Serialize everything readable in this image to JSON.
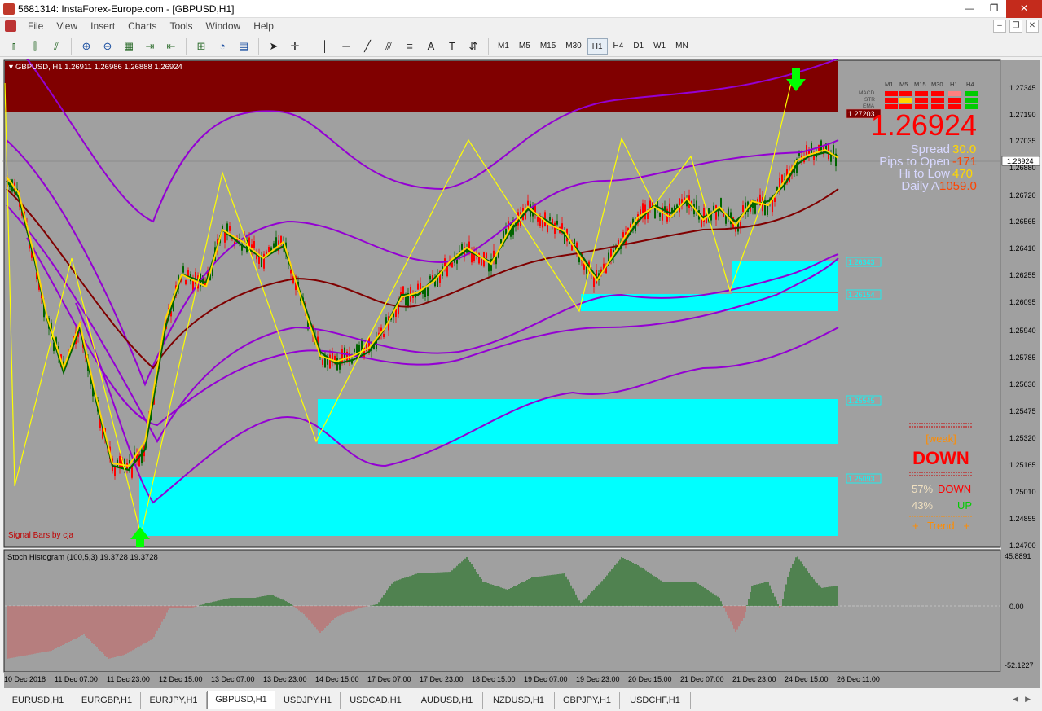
{
  "window": {
    "title": "5681314: InstaForex-Europe.com - [GBPUSD,H1]",
    "controls": [
      "—",
      "❐",
      "✕"
    ]
  },
  "menu": {
    "items": [
      "File",
      "View",
      "Insert",
      "Charts",
      "Tools",
      "Window",
      "Help"
    ],
    "right_icons": [
      "–",
      "❐",
      "✕"
    ]
  },
  "toolbar": {
    "timeframes": [
      "M1",
      "M5",
      "M15",
      "M30",
      "H1",
      "H4",
      "D1",
      "W1",
      "MN"
    ],
    "active_timeframe": "H1"
  },
  "chart": {
    "header": "GBPUSD, H1  1.26911 1.26986 1.26888 1.26924",
    "price_labels": [
      "1.27345",
      "1.27190",
      "1.27035",
      "1.26880",
      "1.26720",
      "1.26565",
      "1.26410",
      "1.26255",
      "1.26095",
      "1.25940",
      "1.25785",
      "1.25630",
      "1.25475",
      "1.25320",
      "1.25165",
      "1.25010",
      "1.24855",
      "1.24700"
    ],
    "current_price_tag": "1.26924",
    "zone_labels": [
      "1.27203",
      "1.26343",
      "1.26154",
      "1.25545",
      "1.25093"
    ],
    "signal_text": "Signal Bars by cja",
    "colors": {
      "background": "#a0a0a0",
      "resistance": "#800000",
      "support": "#00ffff",
      "bands": "#9400d3",
      "zigzag": "#ffff00",
      "ma_slow": "#800000",
      "ma_fast": "#ffd700",
      "ma_green": "#006400"
    }
  },
  "info_panel": {
    "tf_headers": [
      "M1",
      "M5",
      "M15",
      "M30",
      "H1",
      "H4"
    ],
    "row_labels": [
      "MACD",
      "STR",
      "EMA"
    ],
    "big_price": "1.26924",
    "stats": [
      {
        "label": "Spread",
        "value": "30.0"
      },
      {
        "label": "Pips to Open",
        "value": "-171"
      },
      {
        "label": "Hi to Low",
        "value": "470"
      },
      {
        "label": "Daily A",
        "value": "1059.0"
      }
    ],
    "weak": "[weak]",
    "direction": "DOWN",
    "down_pct": "57%",
    "down_label": "DOWN",
    "up_pct": "43%",
    "up_label": "UP",
    "trend": "+   Trend   +"
  },
  "indicator": {
    "header": "Stoch Histogram (100,5,3) 19.3728 19.3728",
    "levels": [
      "45.8891",
      "0.00",
      "-52.1227"
    ]
  },
  "time_axis": [
    "10 Dec 2018",
    "11 Dec 07:00",
    "11 Dec 23:00",
    "12 Dec 15:00",
    "13 Dec 07:00",
    "13 Dec 23:00",
    "14 Dec 15:00",
    "17 Dec 07:00",
    "17 Dec 23:00",
    "18 Dec 15:00",
    "19 Dec 07:00",
    "19 Dec 23:00",
    "20 Dec 15:00",
    "21 Dec 07:00",
    "21 Dec 23:00",
    "24 Dec 15:00",
    "26 Dec 11:00"
  ],
  "tabs": [
    "EURUSD,H1",
    "EURGBP,H1",
    "EURJPY,H1",
    "GBPUSD,H1",
    "USDJPY,H1",
    "USDCAD,H1",
    "AUDUSD,H1",
    "NZDUSD,H1",
    "GBPJPY,H1",
    "USDCHF,H1"
  ],
  "active_tab": "GBPUSD,H1"
}
